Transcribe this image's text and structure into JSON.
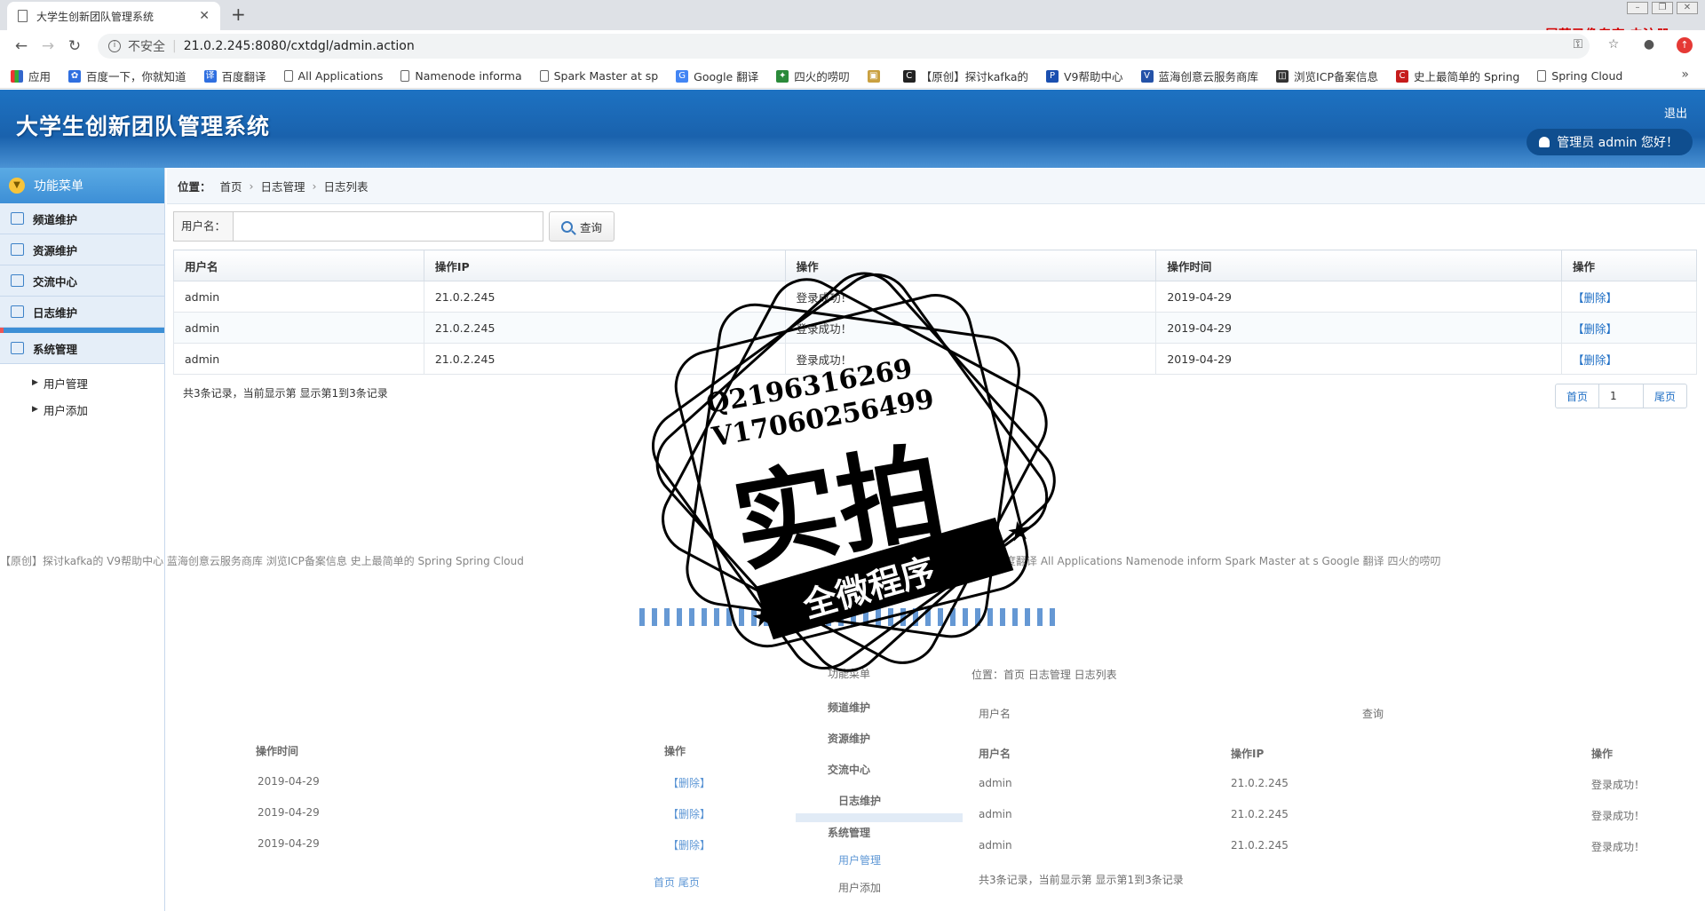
{
  "browser": {
    "tab_title": "大学生创新团队管理系统",
    "new_tab": "+",
    "insecure": "不安全",
    "url": "21.0.2.245:8080/cxtdgl/admin.action",
    "recorder_watermark": "屏幕录像专家 未注册",
    "bookmarks": [
      "应用",
      "百度一下，你就知道",
      "百度翻译",
      "All Applications",
      "Namenode informa",
      "Spark Master at sp",
      "Google 翻译",
      "四火的唠叨",
      "【原创】探讨kafka的",
      "V9帮助中心",
      "蓝海创意云服务商库",
      "浏览ICP备案信息",
      "史上最简单的 Spring",
      "Spring Cloud"
    ]
  },
  "app": {
    "title": "大学生创新团队管理系统",
    "logout": "退出",
    "welcome": "管理员 admin 您好！"
  },
  "sidebar": {
    "header": "功能菜单",
    "items": [
      "频道维护",
      "资源维护",
      "交流中心",
      "日志维护"
    ],
    "system": "系统管理",
    "sub": [
      "用户管理",
      "用户添加"
    ]
  },
  "breadcrumb": {
    "label": "位置：",
    "items": [
      "首页",
      "日志管理",
      "日志列表"
    ]
  },
  "search": {
    "label": "用户名：",
    "button": "查询"
  },
  "table": {
    "headers": [
      "用户名",
      "操作IP",
      "操作",
      "操作时间",
      "操作"
    ],
    "rows": [
      [
        "admin",
        "21.0.2.245",
        "登录成功！",
        "2019-04-29",
        "【删除】"
      ],
      [
        "admin",
        "21.0.2.245",
        "登录成功！",
        "2019-04-29",
        "【删除】"
      ],
      [
        "admin",
        "21.0.2.245",
        "登录成功！",
        "2019-04-29",
        "【删除】"
      ]
    ]
  },
  "summary": "共3条记录，当前显示第 显示第1到3条记录",
  "pager": {
    "first": "首页",
    "current": "1",
    "last": "尾页"
  },
  "ghost": {
    "bookmarks_left": "【原创】探讨kafka的   V9帮助中心   蓝海创意云服务商库   浏览ICP备案信息   史上最简单的 Spring   Spring Cloud",
    "bookmarks_right": "百度翻译   All Applications   Namenode inform   Spark Master at s   Google 翻译   四火的唠叨",
    "headers_left": [
      "操作时间",
      "操作"
    ],
    "dates": [
      "2019-04-29",
      "2019-04-29",
      "2019-04-29"
    ],
    "delete": "【删除】",
    "menu": [
      "功能菜单",
      "频道维护",
      "资源维护",
      "交流中心",
      "日志维护",
      "系统管理",
      "用户管理",
      "用户添加"
    ],
    "crumb": "位置：首页 日志管理 日志列表",
    "user_label": "用户名",
    "query": "查询",
    "headers_right": [
      "用户名",
      "操作IP",
      "操作"
    ],
    "rows_right": [
      [
        "admin",
        "21.0.2.245",
        "登录成功！"
      ],
      [
        "admin",
        "21.0.2.245",
        "登录成功！"
      ],
      [
        "admin",
        "21.0.2.245",
        "登录成功！"
      ]
    ],
    "summary": "共3条记录，当前显示第 显示第1到3条记录",
    "pager": "首页  尾页"
  },
  "stamp": {
    "line1": "Q2196316269",
    "line2": "V17060256499",
    "big": "实拍",
    "banner": "全微程序"
  }
}
